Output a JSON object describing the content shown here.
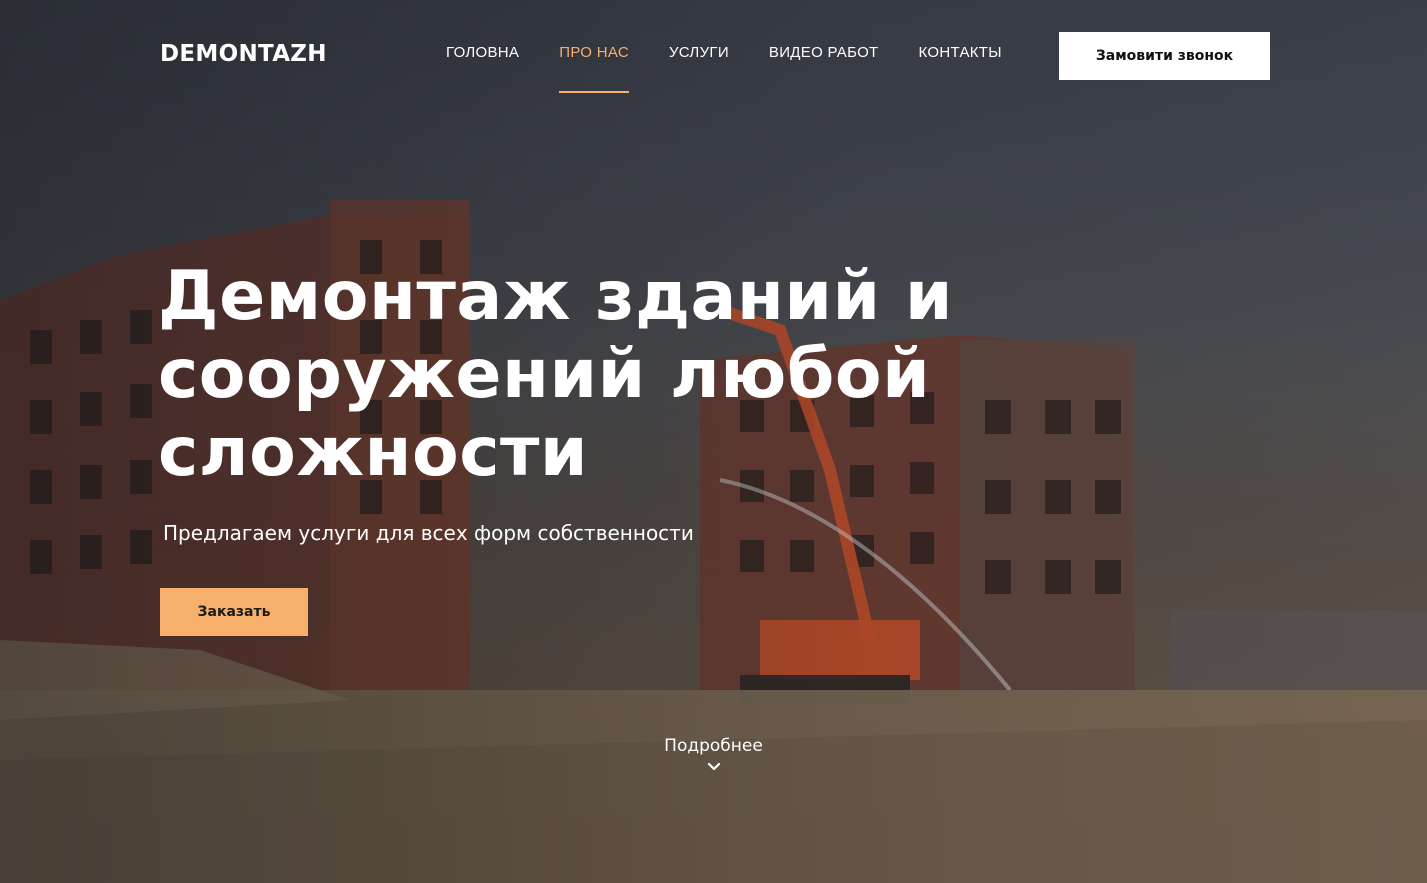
{
  "header": {
    "logo": "DEMONTAZH",
    "nav": [
      {
        "label": "ГОЛОВНА",
        "active": false
      },
      {
        "label": "ПРО НАС",
        "active": true
      },
      {
        "label": "УСЛУГИ",
        "active": false
      },
      {
        "label": "ВИДЕО РАБОТ",
        "active": false
      },
      {
        "label": "КОНТАКТЫ",
        "active": false
      }
    ],
    "call_button": "Замовити звонок"
  },
  "hero": {
    "headline_line1": "Демонтаж зданий и",
    "headline_line2": "сооружений любой",
    "headline_line3": "сложности",
    "subline": "Предлагаем услуги для всех форм собственности",
    "order_button": "Заказать",
    "more_label": "Подробнее",
    "more_icon": "chevron-down-icon"
  },
  "colors": {
    "accent": "#f6b06b",
    "white": "#ffffff"
  }
}
